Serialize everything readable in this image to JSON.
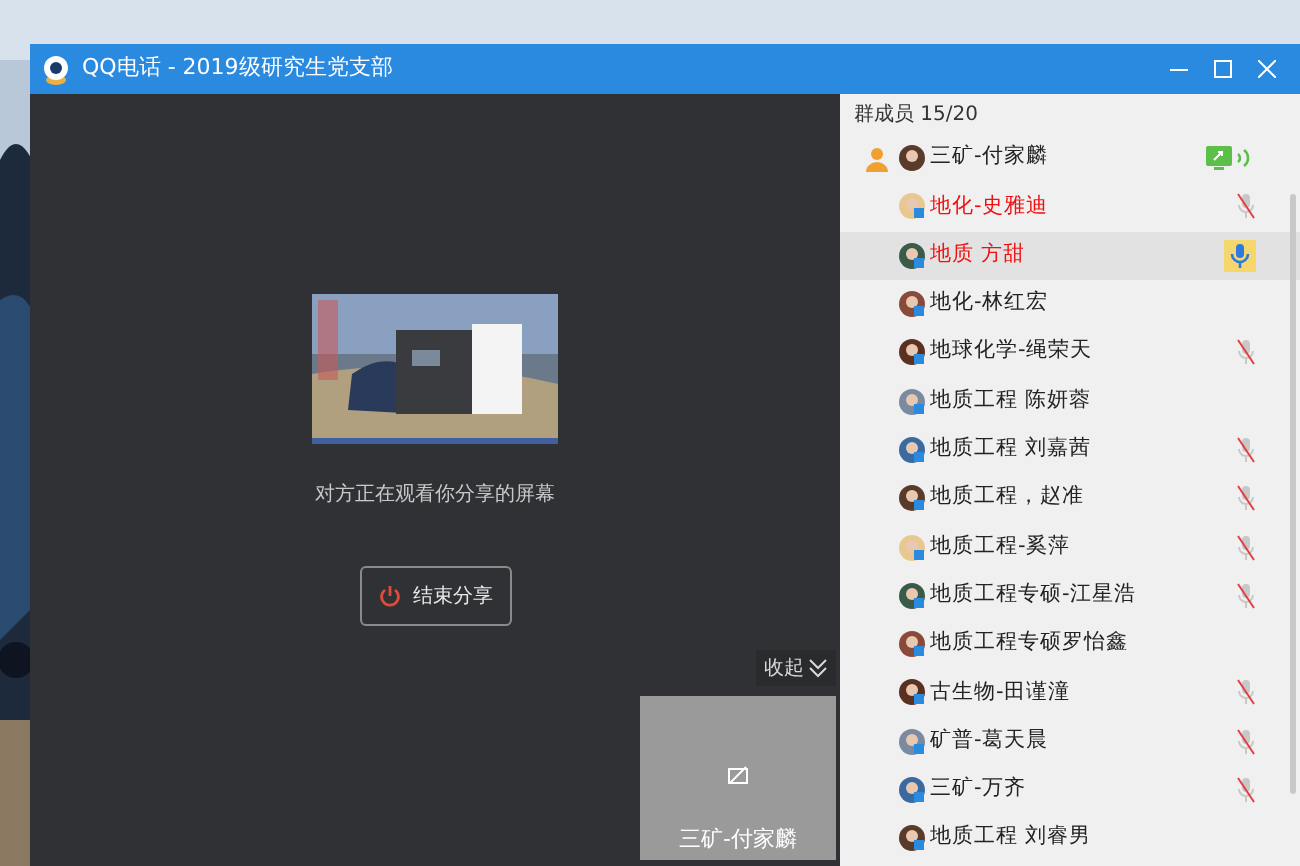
{
  "window": {
    "title": "QQ电话 - 2019级研究生党支部"
  },
  "share": {
    "status": "对方正在观看你分享的屏幕",
    "stop_button": "结束分享",
    "collapse": "收起",
    "tile_name": "三矿-付家麟"
  },
  "members_header": "群成员 15/20",
  "members": [
    {
      "name": "三矿-付家麟",
      "host": true,
      "red": false,
      "selected": false,
      "sharing": true,
      "muted": false,
      "speaking": false
    },
    {
      "name": "地化-史雅迪",
      "host": false,
      "red": true,
      "selected": false,
      "sharing": false,
      "muted": true,
      "speaking": false
    },
    {
      "name": "地质 方甜",
      "host": false,
      "red": true,
      "selected": true,
      "sharing": false,
      "muted": false,
      "speaking": true
    },
    {
      "name": "地化-林红宏",
      "host": false,
      "red": false,
      "selected": false,
      "sharing": false,
      "muted": false,
      "speaking": false
    },
    {
      "name": "地球化学-绳荣天",
      "host": false,
      "red": false,
      "selected": false,
      "sharing": false,
      "muted": true,
      "speaking": false
    },
    {
      "name": "地质工程 陈妍蓉",
      "host": false,
      "red": false,
      "selected": false,
      "sharing": false,
      "muted": false,
      "speaking": false
    },
    {
      "name": "地质工程 刘嘉茜",
      "host": false,
      "red": false,
      "selected": false,
      "sharing": false,
      "muted": true,
      "speaking": false
    },
    {
      "name": "地质工程，赵准",
      "host": false,
      "red": false,
      "selected": false,
      "sharing": false,
      "muted": true,
      "speaking": false
    },
    {
      "name": "地质工程-奚萍",
      "host": false,
      "red": false,
      "selected": false,
      "sharing": false,
      "muted": true,
      "speaking": false
    },
    {
      "name": "地质工程专硕-江星浩",
      "host": false,
      "red": false,
      "selected": false,
      "sharing": false,
      "muted": true,
      "speaking": false
    },
    {
      "name": "地质工程专硕罗怡鑫",
      "host": false,
      "red": false,
      "selected": false,
      "sharing": false,
      "muted": false,
      "speaking": false
    },
    {
      "name": "古生物-田谨潼",
      "host": false,
      "red": false,
      "selected": false,
      "sharing": false,
      "muted": true,
      "speaking": false
    },
    {
      "name": "矿普-葛天晨",
      "host": false,
      "red": false,
      "selected": false,
      "sharing": false,
      "muted": true,
      "speaking": false
    },
    {
      "name": "三矿-万齐",
      "host": false,
      "red": false,
      "selected": false,
      "sharing": false,
      "muted": true,
      "speaking": false
    },
    {
      "name": "地质工程 刘睿男",
      "host": false,
      "red": false,
      "selected": false,
      "sharing": false,
      "muted": false,
      "speaking": false
    }
  ]
}
